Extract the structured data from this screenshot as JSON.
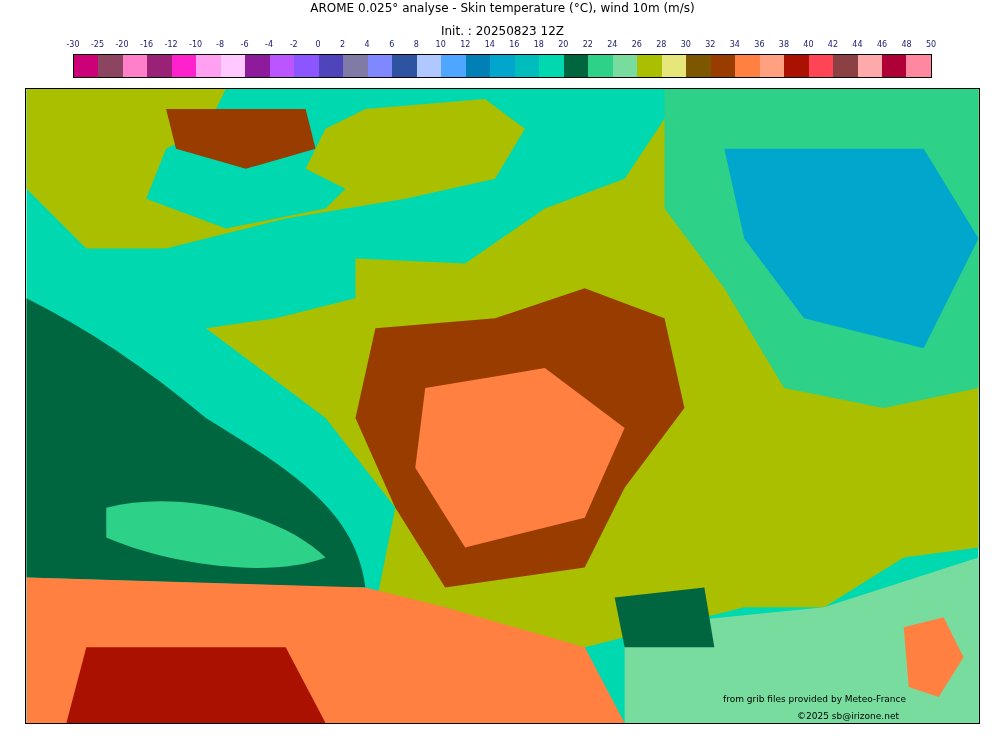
{
  "title": "AROME 0.025° analyse - Skin temperature (°C), wind 10m (m/s)",
  "subtitle": "Init. : 20250823 12Z",
  "colorbar": {
    "labels": [
      "-30",
      "-25",
      "-20",
      "-16",
      "-12",
      "-10",
      "-8",
      "-6",
      "-4",
      "-2",
      "0",
      "2",
      "4",
      "6",
      "8",
      "10",
      "12",
      "14",
      "16",
      "18",
      "20",
      "22",
      "24",
      "26",
      "28",
      "30",
      "32",
      "34",
      "36",
      "38",
      "40",
      "42",
      "44",
      "46",
      "48",
      "50"
    ],
    "swatches": [
      {
        "color": "#cc0077"
      },
      {
        "color": "#8b4560"
      },
      {
        "color": "#ff80c8"
      },
      {
        "color": "#992277"
      },
      {
        "color": "#ff22cc"
      },
      {
        "color": "#ffa0f0"
      },
      {
        "color": "#ffc8ff"
      },
      {
        "color": "#8e1a9c"
      },
      {
        "color": "#bb55ff"
      },
      {
        "color": "#8b55ff"
      },
      {
        "color": "#4f44bb"
      },
      {
        "color": "#7f7aa6"
      },
      {
        "color": "#8088ff"
      },
      {
        "color": "#2e53a0"
      },
      {
        "color": "#b0c8ff"
      },
      {
        "color": "#4ea6ff"
      },
      {
        "color": "#0080b4"
      },
      {
        "color": "#00a6cc"
      },
      {
        "color": "#00bdbd"
      },
      {
        "color": "#00d8b0"
      },
      {
        "color": "#006640"
      },
      {
        "color": "#2ed188"
      },
      {
        "color": "#78dc9e"
      },
      {
        "color": "#aabf00"
      },
      {
        "color": "#e6e67a"
      },
      {
        "color": "#7d5600"
      },
      {
        "color": "#993c00"
      },
      {
        "color": "#ff8040"
      },
      {
        "color": "#ffa080"
      },
      {
        "color": "#aa1100"
      },
      {
        "color": "#ff4455"
      },
      {
        "color": "#8b4044"
      },
      {
        "color": "#ffaaaa"
      },
      {
        "color": "#b00038"
      },
      {
        "color": "#ff88a0"
      }
    ]
  },
  "map": {
    "credit": "from grib files provided by Meteo-France",
    "copyright": "©2025 sb@irizone.net"
  }
}
